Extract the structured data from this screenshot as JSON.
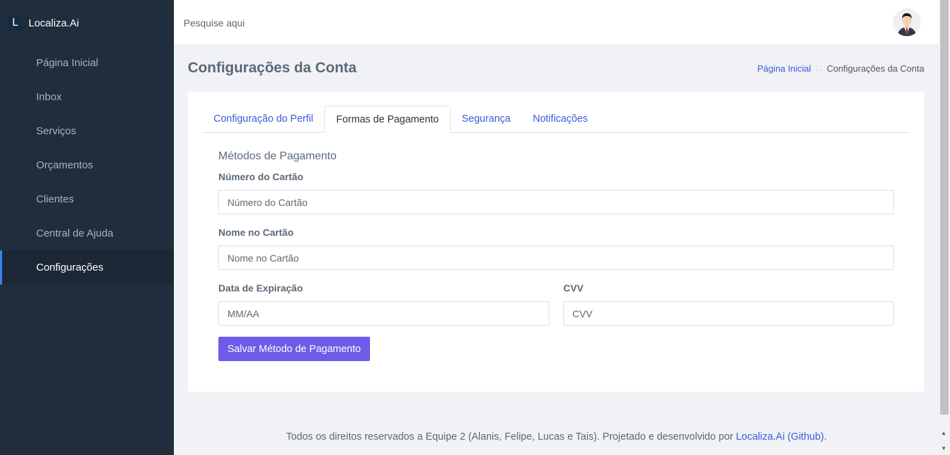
{
  "brand": {
    "logo_letter": "L",
    "name": "Localiza.Ai"
  },
  "sidebar": {
    "items": [
      {
        "label": "Página Inicial"
      },
      {
        "label": "Inbox"
      },
      {
        "label": "Serviços"
      },
      {
        "label": "Orçamentos"
      },
      {
        "label": "Clientes"
      },
      {
        "label": "Central de Ajuda"
      },
      {
        "label": "Configurações",
        "active": true
      }
    ]
  },
  "topbar": {
    "search_placeholder": "Pesquise aqui",
    "avatar_icon": "user-avatar-icon"
  },
  "page": {
    "title": "Configurações da Conta",
    "breadcrumb": {
      "home": "Página Inicial",
      "current": "Configurações da Conta"
    }
  },
  "tabs": [
    {
      "label": "Configuração do Perfil"
    },
    {
      "label": "Formas de Pagamento",
      "active": true
    },
    {
      "label": "Segurança"
    },
    {
      "label": "Notificações"
    }
  ],
  "form": {
    "section_title": "Métodos de Pagamento",
    "card_number": {
      "label": "Número do Cartão",
      "placeholder": "Número do Cartão"
    },
    "card_name": {
      "label": "Nome no Cartão",
      "placeholder": "Nome no Cartão"
    },
    "expiry": {
      "label": "Data de Expiração",
      "placeholder": "MM/AA"
    },
    "cvv": {
      "label": "CVV",
      "placeholder": "CVV"
    },
    "submit_label": "Salvar Método de Pagamento"
  },
  "footer": {
    "text": "Todos os direitos reservados a Equipe 2 (Alanis, Felipe, Lucas e Tais). Projetado e desenvolvido por ",
    "link": "Localiza.Ai (Github)",
    "end": "."
  },
  "colors": {
    "sidebar_bg": "#1f2d3d",
    "accent": "#6c5ce7",
    "link": "#3b5bdb",
    "active_indicator": "#3b82f6"
  }
}
